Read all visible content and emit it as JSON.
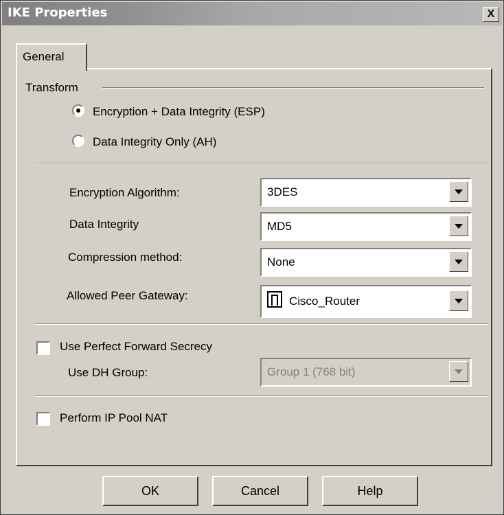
{
  "window": {
    "title": "IKE Properties",
    "close_label": "X"
  },
  "tabs": [
    {
      "label": "General",
      "selected": true
    }
  ],
  "transform": {
    "label": "Transform",
    "options": [
      {
        "label": "Encryption + Data Integrity (ESP)",
        "selected": true
      },
      {
        "label": "Data Integrity Only (AH)",
        "selected": false
      }
    ]
  },
  "fields": {
    "encryption_algorithm": {
      "label": "Encryption Algorithm:",
      "value": "3DES"
    },
    "data_integrity": {
      "label": "Data Integrity",
      "value": "MD5"
    },
    "compression_method": {
      "label": "Compression method:",
      "value": "None"
    },
    "allowed_peer_gateway": {
      "label": "Allowed Peer Gateway:",
      "value": "Cisco_Router",
      "icon": "gateway-icon"
    }
  },
  "pfs": {
    "checkbox_label": "Use Perfect Forward Secrecy",
    "checked": false,
    "dh_label": "Use DH Group:",
    "dh_value": "Group 1 (768 bit)",
    "dh_enabled": false
  },
  "ip_pool_nat": {
    "label": "Perform IP Pool NAT",
    "checked": false
  },
  "buttons": {
    "ok": "OK",
    "cancel": "Cancel",
    "help": "Help"
  }
}
